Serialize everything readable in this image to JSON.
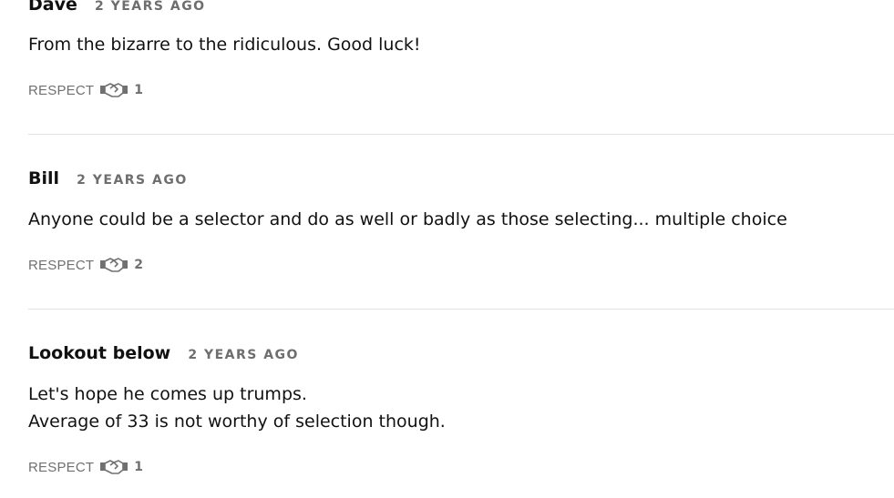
{
  "comments": [
    {
      "author": "Dave",
      "timestamp": "2 YEARS AGO",
      "body": [
        "From the bizarre to the ridiculous. Good luck!"
      ],
      "respect_label": "RESPECT",
      "respect_count": "1"
    },
    {
      "author": "Bill",
      "timestamp": "2 YEARS AGO",
      "body": [
        "Anyone could be a selector and do as well or badly as those selecting... multiple choice"
      ],
      "respect_label": "RESPECT",
      "respect_count": "2"
    },
    {
      "author": "Lookout below",
      "timestamp": "2 YEARS AGO",
      "body": [
        "Let's hope he comes up trumps.",
        "Average of 33 is not worthy of selection though."
      ],
      "respect_label": "RESPECT",
      "respect_count": "1"
    }
  ],
  "colors": {
    "text": "#111111",
    "muted": "#707070",
    "divider": "#e3e3e3",
    "background": "#ffffff"
  },
  "icons": {
    "respect": "handshake-icon"
  }
}
